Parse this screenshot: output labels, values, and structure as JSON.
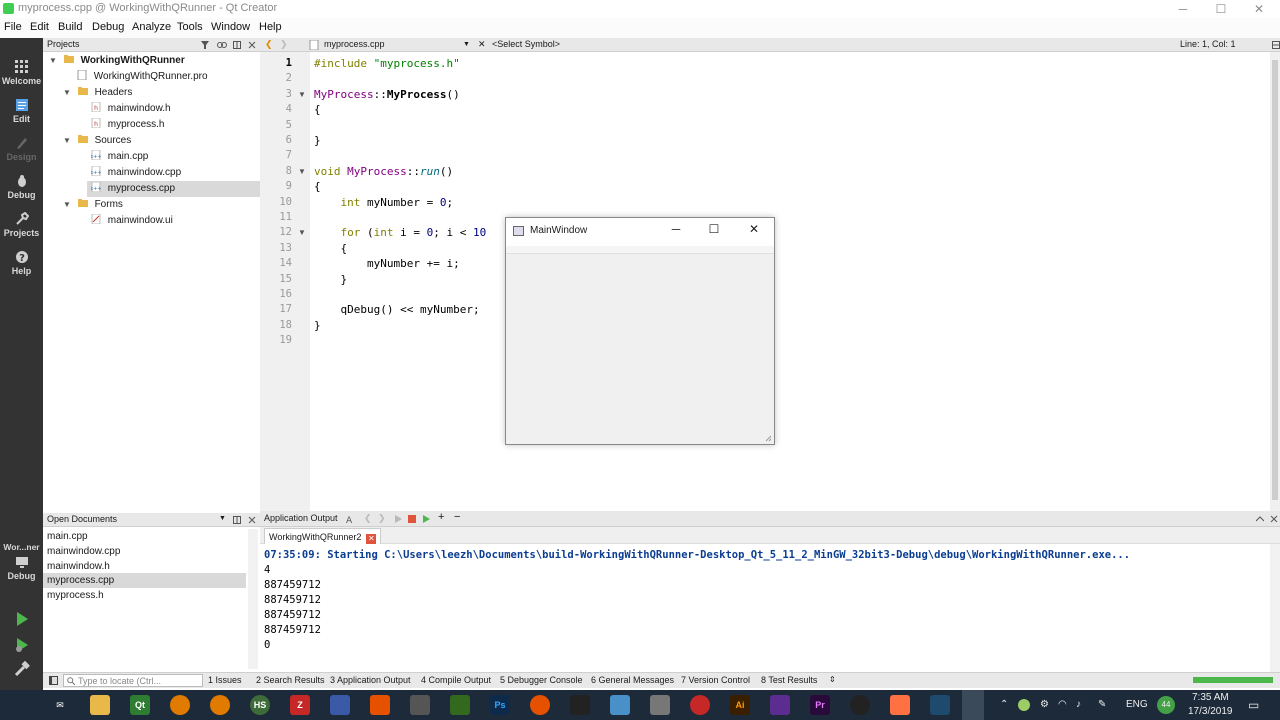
{
  "window": {
    "title": "myprocess.cpp @ WorkingWithQRunner - Qt Creator",
    "controls": [
      "─",
      "☐",
      "✕"
    ]
  },
  "menu": [
    "File",
    "Edit",
    "Build",
    "Debug",
    "Analyze",
    "Tools",
    "Window",
    "Help"
  ],
  "modes": [
    {
      "label": "Welcome",
      "icon": "welcome-grid-icon"
    },
    {
      "label": "Edit",
      "icon": "edit-doc-icon"
    },
    {
      "label": "Design",
      "icon": "design-pen-icon"
    },
    {
      "label": "Debug",
      "icon": "debug-bug-icon"
    },
    {
      "label": "Projects",
      "icon": "projects-wrench-icon"
    },
    {
      "label": "Help",
      "icon": "help-question-icon"
    }
  ],
  "run_target": {
    "label": "Wor...ner",
    "config": "Debug"
  },
  "projects_panel": {
    "title": "Projects",
    "tree": [
      {
        "label": "WorkingWithQRunner",
        "bold": true
      },
      {
        "label": "WorkingWithQRunner.pro"
      },
      {
        "label": "Headers"
      },
      {
        "label": "mainwindow.h"
      },
      {
        "label": "myprocess.h"
      },
      {
        "label": "Sources"
      },
      {
        "label": "main.cpp"
      },
      {
        "label": "mainwindow.cpp"
      },
      {
        "label": "myprocess.cpp",
        "selected": true
      },
      {
        "label": "Forms"
      },
      {
        "label": "mainwindow.ui"
      }
    ]
  },
  "editor": {
    "file_tab": "myprocess.cpp",
    "symbol": "<Select Symbol>",
    "position": "Line: 1, Col: 1",
    "line_numbers": [
      "1",
      "2",
      "3",
      "4",
      "5",
      "6",
      "7",
      "8",
      "9",
      "10",
      "11",
      "12",
      "13",
      "14",
      "15",
      "16",
      "17",
      "18",
      "19"
    ]
  },
  "popup": {
    "title": "MainWindow"
  },
  "open_documents": {
    "title": "Open Documents",
    "items": [
      "main.cpp",
      "mainwindow.cpp",
      "mainwindow.h",
      "myprocess.cpp",
      "myprocess.h"
    ],
    "selected_index": 3
  },
  "output": {
    "header": "Application Output",
    "tab": "WorkingWithQRunner2",
    "lines": [
      "07:35:09: Starting C:\\Users\\leezh\\Documents\\build-WorkingWithQRunner-Desktop_Qt_5_11_2_MinGW_32bit3-Debug\\debug\\WorkingWithQRunner.exe...",
      "4",
      "887459712",
      "887459712",
      "887459712",
      "887459712",
      "0"
    ]
  },
  "statusbar": {
    "locate_placeholder": "Type to locate (Ctrl...",
    "panes": [
      "1 Issues",
      "2 Search Results",
      "3 Application Output",
      "4 Compile Output",
      "5 Debugger Console",
      "6 General Messages",
      "7 Version Control",
      "8 Test Results"
    ]
  },
  "tray": {
    "lang": "ENG",
    "time": "7:35 AM",
    "date": "17/3/2019",
    "badge": "44"
  }
}
